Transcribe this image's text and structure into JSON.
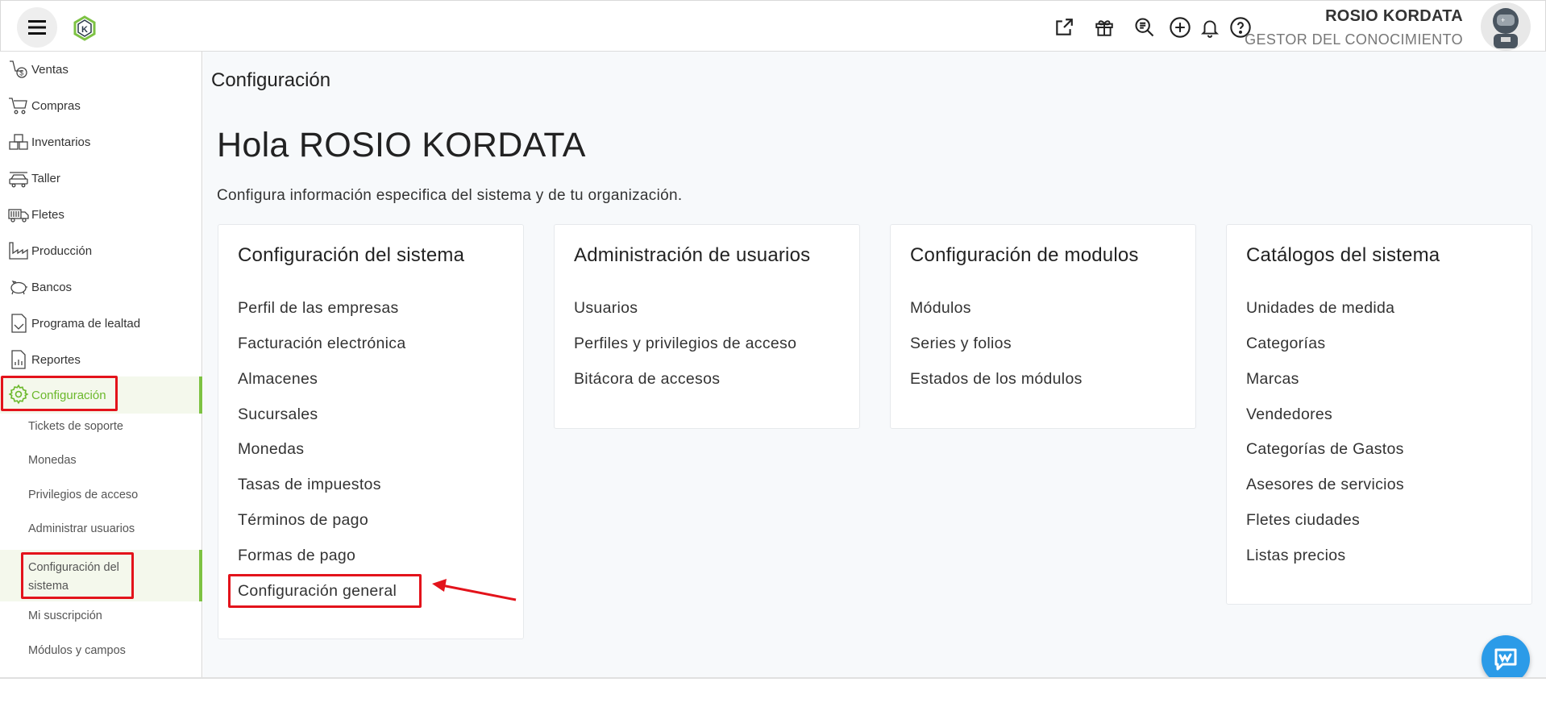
{
  "header": {
    "user_name": "ROSIO KORDATA",
    "user_role": "GESTOR DEL CONOCIMIENTO",
    "icons": [
      "external-link-icon",
      "gift-icon",
      "search-zoom-icon",
      "plus-circle-icon",
      "bell-icon",
      "help-icon"
    ]
  },
  "sidebar": {
    "items": [
      {
        "label": "Ventas",
        "icon": "sales-icon"
      },
      {
        "label": "Compras",
        "icon": "cart-icon"
      },
      {
        "label": "Inventarios",
        "icon": "boxes-icon"
      },
      {
        "label": "Taller",
        "icon": "car-icon"
      },
      {
        "label": "Fletes",
        "icon": "truck-icon"
      },
      {
        "label": "Producción",
        "icon": "factory-icon"
      },
      {
        "label": "Bancos",
        "icon": "piggy-bank-icon"
      },
      {
        "label": "Programa de lealtad",
        "icon": "loyalty-icon"
      },
      {
        "label": "Reportes",
        "icon": "report-icon"
      },
      {
        "label": "Configuración",
        "icon": "gear-icon"
      }
    ],
    "subitems": [
      {
        "label": "Tickets de soporte"
      },
      {
        "label": "Monedas"
      },
      {
        "label": "Privilegios de acceso"
      },
      {
        "label": "Administrar usuarios"
      },
      {
        "label": "Configuración del sistema"
      },
      {
        "label": "Mi suscripción"
      },
      {
        "label": "Módulos y campos"
      }
    ],
    "active_color": "#7dc243"
  },
  "main": {
    "page_title": "Configuración",
    "greeting": "Hola ROSIO KORDATA",
    "description": "Configura información especifica del sistema y de tu organización.",
    "cards": [
      {
        "title": "Configuración del sistema",
        "items": [
          "Perfil de las empresas",
          "Facturación electrónica",
          "Almacenes",
          "Sucursales",
          "Monedas",
          "Tasas de impuestos",
          "Términos de pago",
          "Formas de pago",
          "Configuración general"
        ]
      },
      {
        "title": "Administración de usuarios",
        "items": [
          "Usuarios",
          "Perfiles y privilegios de acceso",
          "Bitácora de accesos"
        ]
      },
      {
        "title": "Configuración de modulos",
        "items": [
          "Módulos",
          "Series y folios",
          "Estados de los módulos"
        ]
      },
      {
        "title": "Catálogos del sistema",
        "items": [
          "Unidades de medida",
          "Categorías",
          "Marcas",
          "Vendedores",
          "Categorías de Gastos",
          "Asesores de servicios",
          "Fletes ciudades",
          "Listas precios"
        ]
      }
    ]
  },
  "annotation_color": "#e3131b"
}
